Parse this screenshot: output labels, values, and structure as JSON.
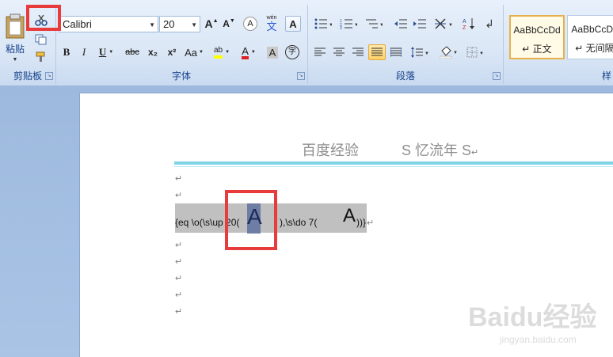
{
  "ribbon": {
    "clipboard": {
      "label": "剪贴板",
      "paste_label": "粘贴"
    },
    "font": {
      "label": "字体",
      "font_name": "Calibri",
      "font_size": "20",
      "grow_label": "A",
      "shrink_label": "A",
      "clear_label": "A",
      "phonetic_top": "wén",
      "phonetic_char": "文",
      "char_border_label": "A",
      "bold": "B",
      "italic": "I",
      "underline": "U",
      "strike": "abc",
      "subscript": "x₂",
      "superscript": "x²",
      "case": "Aa",
      "highlight": "ab",
      "font_color": "A",
      "shading": "A",
      "enclose": "字"
    },
    "paragraph": {
      "label": "段落"
    },
    "styles": {
      "label": "样",
      "tiles": [
        {
          "sample": "AaBbCcDd",
          "name": "↵ 正文"
        },
        {
          "sample": "AaBbCcDd",
          "name": "↵ 无间隔"
        }
      ]
    }
  },
  "document": {
    "header_text": "百度经验　　　S 忆流年 S",
    "header_mark": "↵",
    "para_mark": "↵",
    "field_part1": "{eq \\o(\\s\\up 20(",
    "field_a1": "A",
    "field_part2": "),\\s\\do 7(",
    "field_a2": "A",
    "field_part3": "))}",
    "field_mark": "↵"
  },
  "watermark": {
    "brand": "Baidu经验",
    "url": "jingyan.baidu.com"
  },
  "colors": {
    "accent_red": "#e83b3b",
    "header_line": "#7fd3e6",
    "field_shading": "#c0c0c0"
  }
}
